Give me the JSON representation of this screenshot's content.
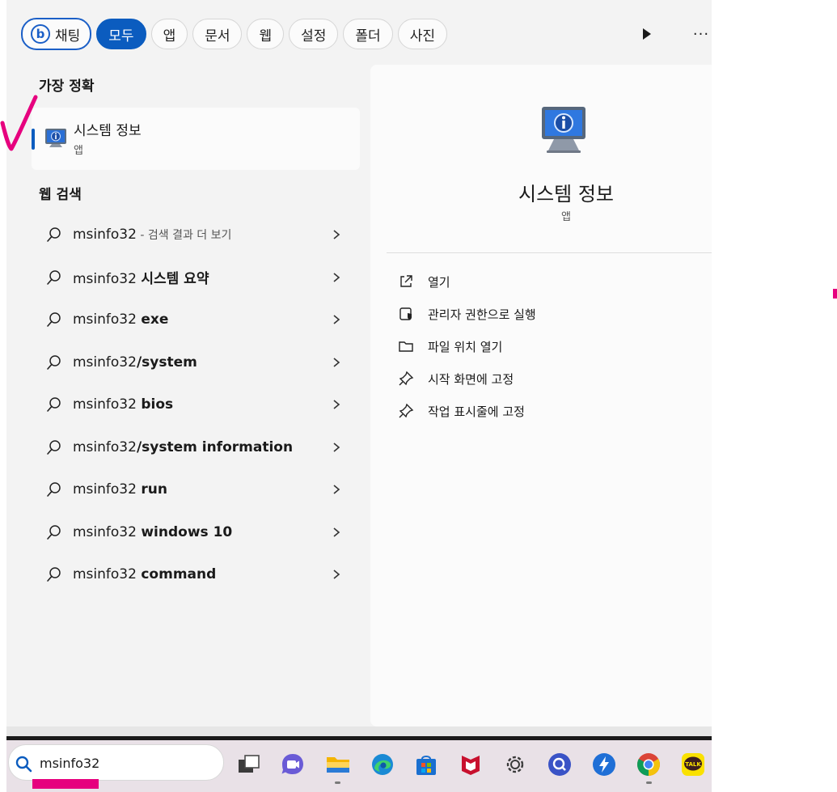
{
  "filters": {
    "chat": "채팅",
    "items": [
      "모두",
      "앱",
      "문서",
      "웹",
      "설정",
      "폴더",
      "사진"
    ],
    "active": "모두",
    "bing_letter": "b",
    "more": "···"
  },
  "best_match": {
    "heading": "가장 정확",
    "name": "시스템 정보",
    "kind": "앱"
  },
  "web_search": {
    "heading": "웹 검색",
    "results": [
      {
        "plain": "msinfo32",
        "bold": "",
        "dim": " - 검색 결과 더 보기"
      },
      {
        "plain": "msinfo32 ",
        "bold": "시스템 요약",
        "dim": ""
      },
      {
        "plain": "msinfo32 ",
        "bold": "exe",
        "dim": ""
      },
      {
        "plain": "msinfo32",
        "bold": "/system",
        "dim": ""
      },
      {
        "plain": "msinfo32 ",
        "bold": "bios",
        "dim": ""
      },
      {
        "plain": "msinfo32",
        "bold": "/system information",
        "dim": ""
      },
      {
        "plain": "msinfo32 ",
        "bold": "run",
        "dim": ""
      },
      {
        "plain": "msinfo32 ",
        "bold": "windows 10",
        "dim": ""
      },
      {
        "plain": "msinfo32 ",
        "bold": "command",
        "dim": ""
      }
    ]
  },
  "detail": {
    "title": "시스템 정보",
    "kind": "앱",
    "actions": [
      {
        "label": "열기",
        "icon": "open-external-icon"
      },
      {
        "label": "관리자 권한으로 실행",
        "icon": "shield-admin-icon"
      },
      {
        "label": "파일 위치 열기",
        "icon": "folder-icon"
      },
      {
        "label": "시작 화면에 고정",
        "icon": "pin-icon"
      },
      {
        "label": "작업 표시줄에 고정",
        "icon": "pin-icon"
      }
    ]
  },
  "taskbar": {
    "search_value": "msinfo32",
    "apps": [
      "task-view-icon",
      "teams-chat-icon",
      "file-explorer-icon",
      "edge-icon",
      "microsoft-store-icon",
      "mcafee-icon",
      "settings-icon",
      "search-app-icon",
      "lightning-app-icon",
      "chrome-icon",
      "kakaotalk-icon"
    ],
    "kakao_label": "TALK"
  },
  "colors": {
    "accent": "#0b5cbf",
    "annotation": "#e6007e",
    "panel": "#f3f3f3"
  }
}
